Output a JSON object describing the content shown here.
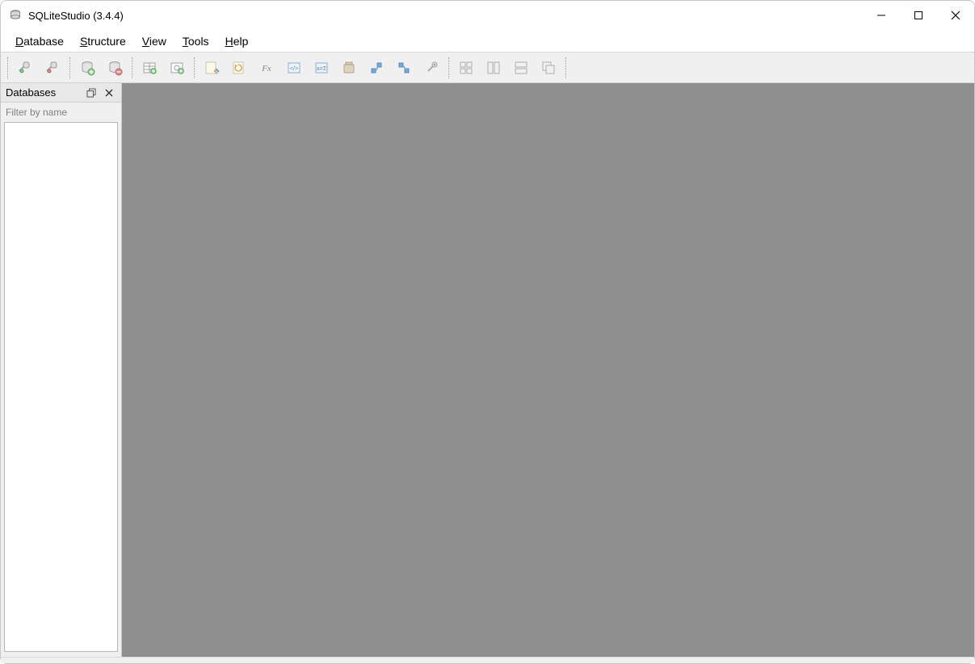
{
  "window": {
    "title": "SQLiteStudio (3.4.4)"
  },
  "menubar": {
    "items": [
      {
        "label": "Database",
        "ukey": "D"
      },
      {
        "label": "Structure",
        "ukey": "S"
      },
      {
        "label": "View",
        "ukey": "V"
      },
      {
        "label": "Tools",
        "ukey": "T"
      },
      {
        "label": "Help",
        "ukey": "H"
      }
    ]
  },
  "toolbar": {
    "groups": [
      [
        "connect-database",
        "disconnect-database"
      ],
      [
        "add-database",
        "remove-database"
      ],
      [
        "new-table",
        "new-view"
      ],
      [
        "open-sql-editor",
        "sql-history",
        "functions-editor",
        "ddl-editor",
        "collations-editor",
        "extension-manager",
        "import",
        "export",
        "configuration"
      ],
      [
        "tile-windows",
        "tile-horizontal",
        "tile-vertical",
        "cascade-windows"
      ]
    ]
  },
  "side_panel": {
    "title": "Databases",
    "filter_placeholder": "Filter by name"
  }
}
